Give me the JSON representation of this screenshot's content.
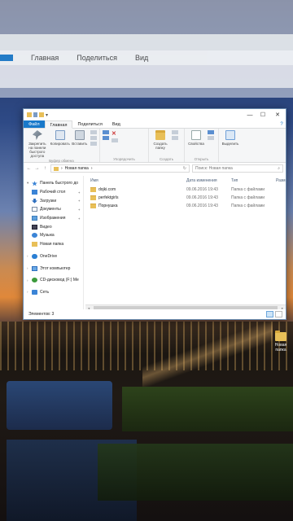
{
  "background": {
    "ghost_tabs": [
      "Главная",
      "Поделиться",
      "Вид"
    ],
    "desktop_icon": {
      "label": "Новая папка"
    }
  },
  "window": {
    "quick_access_chevron": "▾",
    "controls": {
      "minimize": "—",
      "maximize": "☐",
      "close": "✕"
    },
    "tabs": [
      "Файл",
      "Главная",
      "Поделиться",
      "Вид"
    ],
    "help": "?",
    "ribbon": {
      "clipboard": {
        "pin_label": "Закрепить на панели быстрого доступа",
        "copy_label": "Копировать",
        "paste_label": "Вставить",
        "group_label": "Буфер обмена"
      },
      "organize": {
        "group_label": "Упорядочить"
      },
      "new": {
        "new_folder_label": "Создать папку",
        "group_label": "Создать"
      },
      "open": {
        "properties_label": "Свойства",
        "group_label": "Открыть"
      },
      "select": {
        "select_label": "Выделить"
      }
    },
    "address": {
      "back": "←",
      "forward": "→",
      "up": "↑",
      "path": "Новая папка",
      "path_sep": "›",
      "refresh": "↻",
      "search_placeholder": "Поиск: Новая папка",
      "search_icon": "⌕"
    },
    "nav_pane": {
      "items": [
        {
          "label": "Панель быстрого до",
          "icon": "star-icon",
          "pinned": false
        },
        {
          "label": "Рабочий стол",
          "icon": "desktop-icon",
          "pinned": true
        },
        {
          "label": "Загрузки",
          "icon": "download-icon",
          "pinned": true
        },
        {
          "label": "Документы",
          "icon": "documents-icon",
          "pinned": true
        },
        {
          "label": "Изображения",
          "icon": "pictures-icon",
          "pinned": true
        },
        {
          "label": "Видео",
          "icon": "video-icon",
          "pinned": false
        },
        {
          "label": "Музыка",
          "icon": "music-icon",
          "pinned": false
        },
        {
          "label": "Новая папка",
          "icon": "folder-icon",
          "pinned": false
        },
        {
          "label": "OneDrive",
          "icon": "onedrive-icon",
          "pinned": false
        },
        {
          "label": "Этот компьютер",
          "icon": "pc-icon",
          "pinned": false
        },
        {
          "label": "CD-дисковод (F:) Me",
          "icon": "cd-icon",
          "pinned": false
        },
        {
          "label": "Сеть",
          "icon": "network-icon",
          "pinned": false
        }
      ]
    },
    "list": {
      "columns": [
        "Имя",
        "Дата изменения",
        "Тип",
        "Разм"
      ],
      "rows": [
        {
          "name": "dojki.com",
          "date": "09.06.2016 19:43",
          "type": "Папка с файлами"
        },
        {
          "name": "perfektgirls",
          "date": "09.06.2016 19:43",
          "type": "Папка с файлами"
        },
        {
          "name": "Порнушка",
          "date": "09.06.2016 19:43",
          "type": "Папка с файлами"
        }
      ]
    },
    "status": {
      "items_count": "Элементов: 3"
    }
  }
}
